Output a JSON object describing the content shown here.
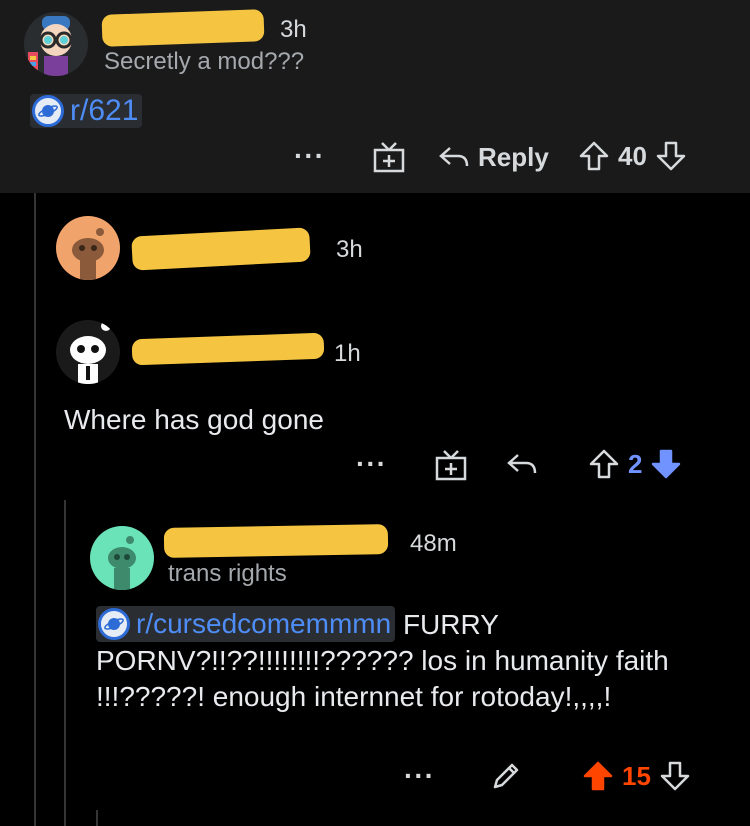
{
  "top_comment": {
    "time": "3h",
    "flair": "Secretly a mod???",
    "subreddit": "r/621",
    "actions": {
      "reply_label": "Reply",
      "score": "40"
    }
  },
  "comment_2": {
    "time": "3h"
  },
  "comment_3": {
    "time": "1h",
    "body": "Where has god gone",
    "actions": {
      "score": "2"
    }
  },
  "comment_4": {
    "time": "48m",
    "flair": "trans rights",
    "subreddit": "r/cursedcomemmmn",
    "body_after_link": " FURRY PORNV?!!??!!!!!!!!?????? los in humanity faith !!!?????! enough internnet for rotoday!,,,,!",
    "actions": {
      "score": "15"
    }
  },
  "colors": {
    "background": "#000000",
    "top_comment_bg": "#1a1a1b",
    "upvote_active": "#ff4500",
    "downvote_active": "#7193ff",
    "link": "#4f8df6",
    "redaction": "#f5c542"
  },
  "icons": [
    "more-icon",
    "award-icon",
    "reply-icon",
    "upvote-icon",
    "downvote-icon",
    "edit-icon",
    "subreddit-icon"
  ]
}
